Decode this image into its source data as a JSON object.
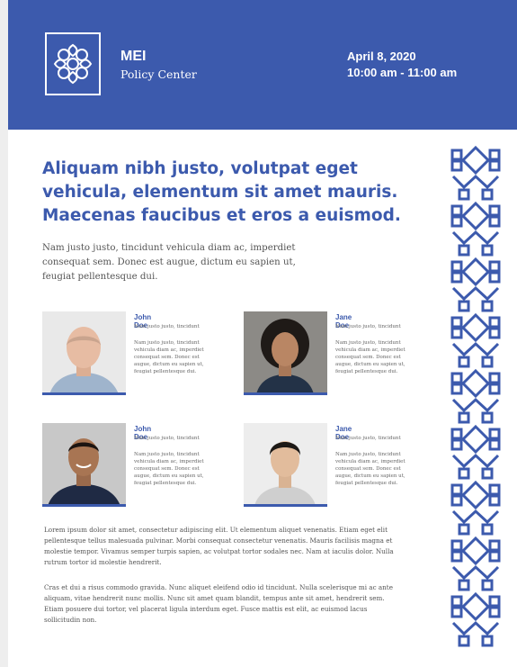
{
  "brand": {
    "name": "MEI",
    "subtitle": "Policy Center",
    "logo_icon": "ornamental-knot-icon"
  },
  "event": {
    "date": "April 8, 2020",
    "time": "10:00 am - 11:00 am"
  },
  "colors": {
    "accent": "#3c5aad",
    "text": "#555555"
  },
  "headline": "Aliquam nibh justo, volutpat eget vehicula, elementum sit amet mauris. Maecenas faucibus et eros a euismod.",
  "intro": "Nam justo justo, tincidunt vehicula diam ac, imperdiet consequat sem. Donec est augue, dictum eu sapien ut, feugiat pellentesque dui.",
  "people": [
    {
      "name": "John Doe",
      "subtitle": "Nam justo justo, tincidunt",
      "bio": "Nam justo justo, tincidunt vehicula diam ac, imperdiet consequat sem. Donec est augue, dictum eu sapien ut, feugiat pellentesque dui."
    },
    {
      "name": "Jane Doe",
      "subtitle": "Nam justo justo, tincidunt",
      "bio": "Nam justo justo, tincidunt vehicula diam ac, imperdiet consequat sem. Donec est augue, dictum eu sapien ut, feugiat pellentesque dui."
    },
    {
      "name": "John Doe",
      "subtitle": "Nam justo justo, tincidunt",
      "bio": "Nam justo justo, tincidunt vehicula diam ac, imperdiet consequat sem. Donec est augue, dictum eu sapien ut, feugiat pellentesque dui."
    },
    {
      "name": "Jane Doe",
      "subtitle": "Nam justo justo, tincidunt",
      "bio": "Nam justo justo, tincidunt vehicula diam ac, imperdiet consequat sem. Donec est augue, dictum eu sapien ut, feugiat pellentesque dui."
    }
  ],
  "body": [
    "Lorem ipsum dolor sit amet, consectetur adipiscing elit. Ut elementum aliquet venenatis. Etiam eget elit pellentesque tellus malesuada pulvinar. Morbi consequat consectetur venenatis. Mauris facilisis magna et molestie tempor. Vivamus semper turpis sapien, ac volutpat tortor sodales nec. Nam at iaculis dolor. Nulla rutrum tortor id molestie hendrerit.",
    "Cras et dui a risus commodo gravida. Nunc aliquet eleifend odio id tincidunt. Nulla scelerisque mi ac ante aliquam, vitae hendrerit nunc mollis. Nunc sit amet quam blandit, tempus ante sit amet, hendrerit sem. Etiam posuere dui tortor, vel placerat ligula interdum eget. Fusce mattis est elit, ac euismod lacus sollicitudin non."
  ]
}
